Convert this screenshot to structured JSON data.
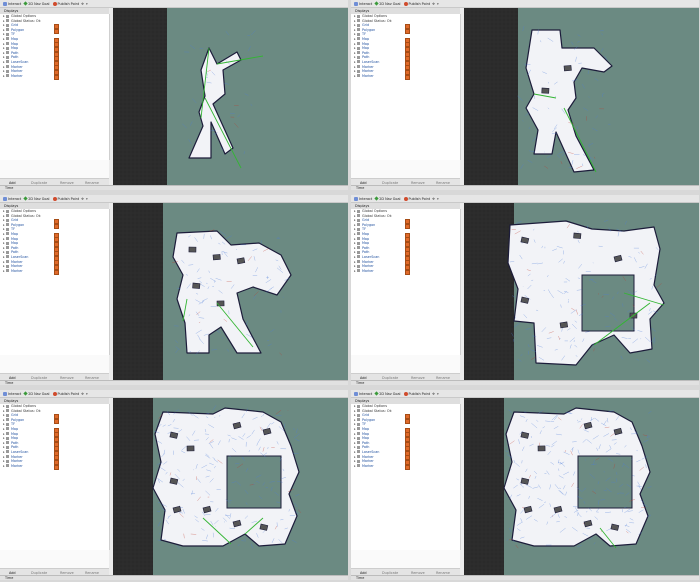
{
  "toolbar": {
    "interact": "Interact",
    "nav": "2D Nav Goal",
    "publish": "Publish Point"
  },
  "displays_title": "Displays",
  "tree": [
    {
      "label": "Global Options",
      "icon": "gear-icon",
      "style": "plain",
      "check": false
    },
    {
      "label": "Global Status: Ok",
      "icon": "check-icon",
      "style": "plain",
      "check": false
    },
    {
      "label": "Grid",
      "icon": "grid-icon",
      "style": "link",
      "check": true
    },
    {
      "label": "Polygon",
      "icon": "polygon-icon",
      "style": "link",
      "check": true
    },
    {
      "label": "TF",
      "icon": "tf-icon",
      "style": "link",
      "check": false
    },
    {
      "label": "Map",
      "icon": "map-icon",
      "style": "link",
      "check": true
    },
    {
      "label": "Map",
      "icon": "map-icon",
      "style": "link",
      "check": true
    },
    {
      "label": "Map",
      "icon": "map-icon",
      "style": "link",
      "check": true
    },
    {
      "label": "Path",
      "icon": "path-icon",
      "style": "link",
      "check": true
    },
    {
      "label": "Path",
      "icon": "path-icon",
      "style": "link",
      "check": true
    },
    {
      "label": "LaserScan",
      "icon": "laser-icon",
      "style": "link",
      "check": true
    },
    {
      "label": "Marker",
      "icon": "marker-icon",
      "style": "link",
      "check": true
    },
    {
      "label": "Marker",
      "icon": "marker-icon",
      "style": "link",
      "check": true
    },
    {
      "label": "Marker",
      "icon": "marker-icon",
      "style": "link",
      "check": true
    }
  ],
  "buttons": {
    "add": "Add",
    "duplicate": "Duplicate",
    "remove": "Remove",
    "rename": "Rename"
  },
  "time_label": "Time",
  "colors": {
    "background": "#6b8a82",
    "grid_area": "#2a2a2a",
    "free_space": "#f2f3f7",
    "laser": "#4d7cd8",
    "path": "#33b533",
    "check": "#e06a2a"
  }
}
